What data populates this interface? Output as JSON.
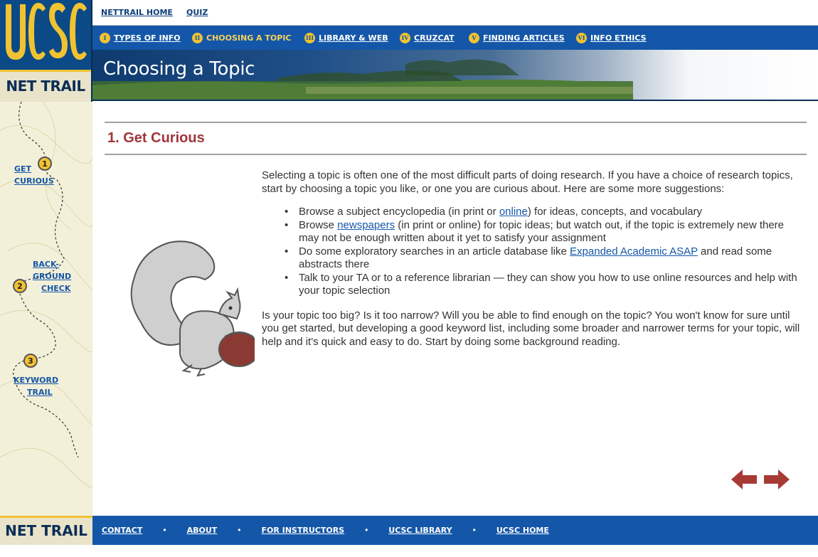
{
  "logo": {
    "letters": "UCSC",
    "nettrail": "NET TRAIL"
  },
  "toplinks": {
    "home": "NETTRAIL HOME",
    "quiz": "QUIZ"
  },
  "nav": [
    {
      "num": "I",
      "label": "TYPES OF INFO"
    },
    {
      "num": "II",
      "label": "CHOOSING A TOPIC"
    },
    {
      "num": "III",
      "label": "LIBRARY & WEB"
    },
    {
      "num": "IV",
      "label": "CRUZCAT"
    },
    {
      "num": "V",
      "label": "FINDING ARTICLES"
    },
    {
      "num": "VI",
      "label": "INFO ETHICS"
    }
  ],
  "banner": {
    "title": "Choosing a Topic"
  },
  "trail": {
    "step1": {
      "num": "1",
      "line1": "GET",
      "line2": "CURIOUS"
    },
    "step2": {
      "num": "2",
      "line1": "BACK-",
      "line2": "GROUND",
      "line3": "CHECK"
    },
    "step3": {
      "num": "3",
      "line1": "KEYWORD",
      "line2": "TRAIL"
    }
  },
  "main": {
    "section_title": "1. Get Curious",
    "intro": "Selecting a topic is often one of the most difficult parts of doing research. If you have a choice of research topics, start by choosing a topic you like, or one you are curious about. Here are some more suggestions:",
    "bullets": [
      {
        "pre": "Browse a subject encyclopedia (in print or ",
        "link": "online",
        "post": ") for ideas, concepts, and vocabulary"
      },
      {
        "pre": "Browse ",
        "link": "newspapers",
        "post": " (in print or online) for topic ideas; but watch out, if the topic is extremely new there may not be enough written about it yet to satisfy your assignment"
      },
      {
        "pre": "Do some exploratory searches in an article database like ",
        "link": "Expanded Academic ASAP",
        "post": " and read some abstracts there"
      },
      {
        "pre": "Talk to your TA or to a reference librarian — they can show you how to use online resources and help with your topic selection",
        "link": "",
        "post": ""
      }
    ],
    "closing": "Is your topic too big? Is it too narrow? Will you be able to find enough on the topic? You won't know for sure until you get started, but developing a good keyword list, including some broader and narrower terms for your topic, will help and it's quick and easy to do. Start by doing some background reading."
  },
  "footer": {
    "nettrail": "NET TRAIL",
    "links": [
      "CONTACT",
      "ABOUT",
      "FOR INSTRUCTORS",
      "UCSC LIBRARY",
      "UCSC HOME"
    ]
  },
  "colors": {
    "nav_blue": "#1457a8",
    "gold": "#f1c232",
    "title_red": "#a0363c",
    "arrow_red": "#a83a36"
  }
}
